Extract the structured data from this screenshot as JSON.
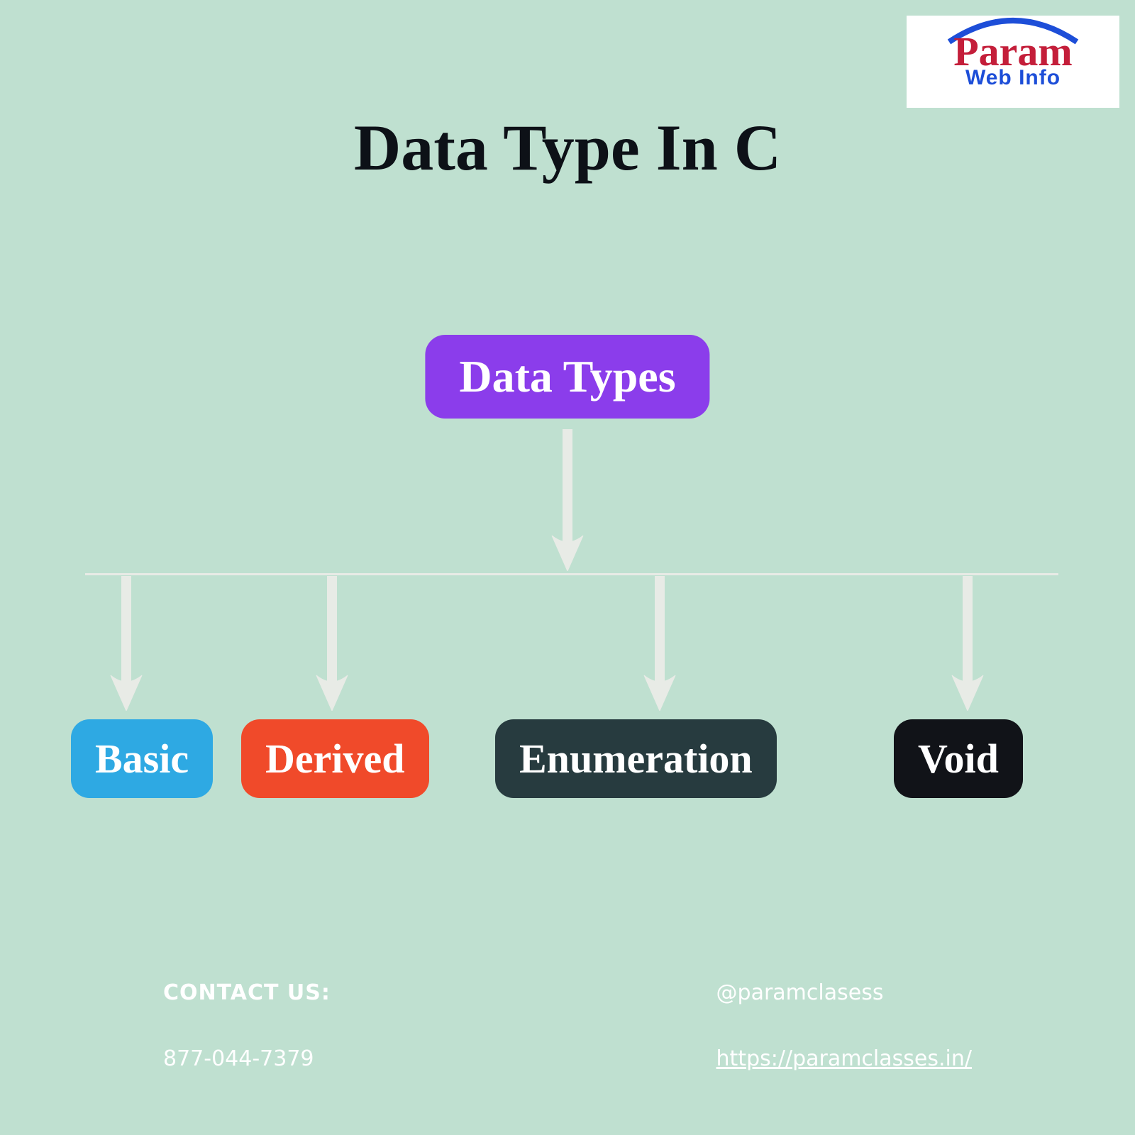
{
  "logo": {
    "line1": "Param",
    "line2": "Web Info"
  },
  "title": "Data Type In C",
  "root": "Data Types",
  "leaves": {
    "basic": "Basic",
    "derived": "Derived",
    "enumeration": "Enumeration",
    "void": "Void"
  },
  "footer": {
    "contact_label": "CONTACT US:",
    "phone": "877-044-7379",
    "handle": "@paramclasess",
    "url": "https://paramclasses.in/"
  },
  "colors": {
    "background": "#bfe0d0",
    "root": "#8b3deb",
    "basic": "#2ea9e3",
    "derived": "#f04a2a",
    "enumeration": "#273b3f",
    "void": "#111318",
    "arrow": "#e8ebe6"
  }
}
